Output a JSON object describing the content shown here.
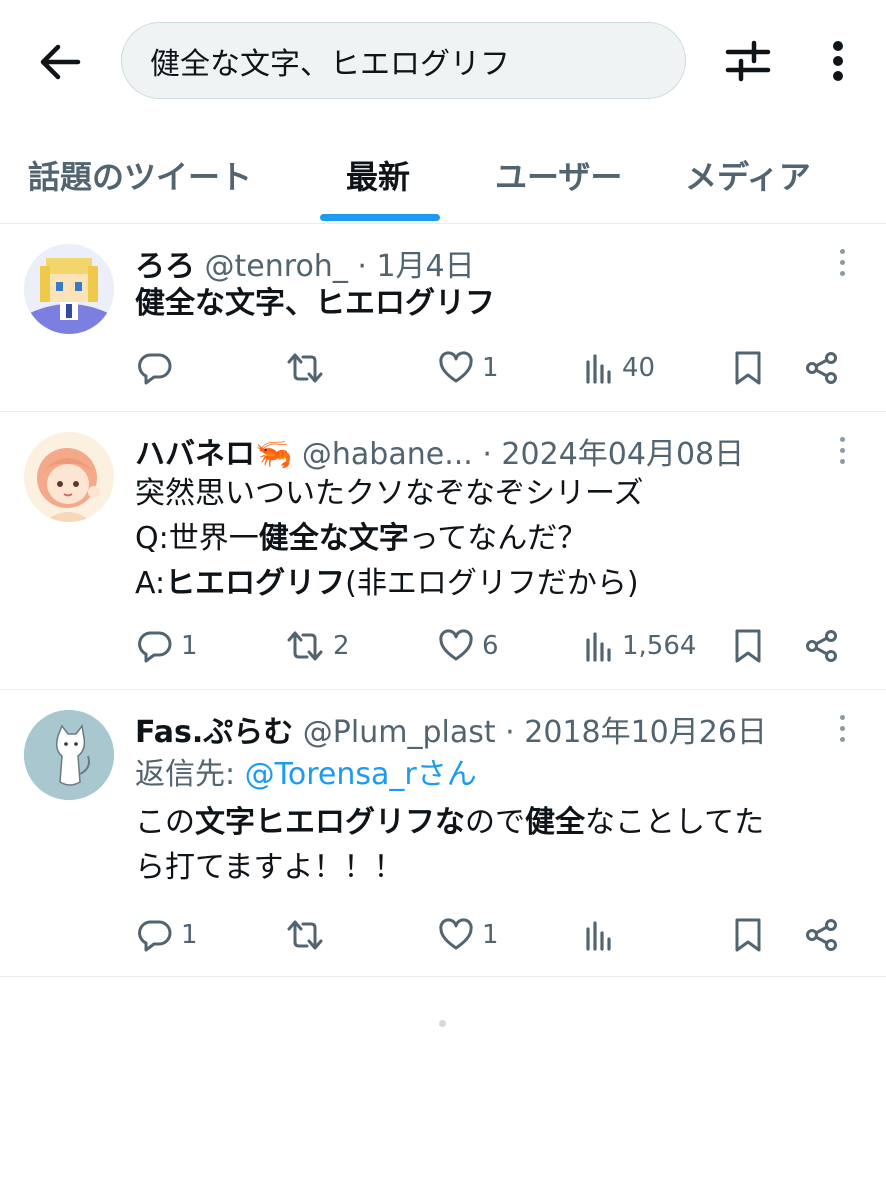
{
  "search": {
    "query": "健全な文字、ヒエログリフ"
  },
  "tabs": [
    "話題のツイート",
    "最新",
    "ユーザー",
    "メディア"
  ],
  "accent": "#1d9bf0",
  "icons": {
    "back": "arrow-left-icon",
    "filter": "sliders-icon",
    "more": "vertical-dots-icon",
    "reply": "reply-bubble-icon",
    "retweet": "retweet-icon",
    "like": "heart-icon",
    "views": "bar-chart-icon",
    "bookmark": "bookmark-icon",
    "share": "share-icon"
  },
  "tweets": [
    {
      "name": "ろろ",
      "handle": "@tenroh_",
      "date": "· 1月4日",
      "text": "健全な文字、ヒエログリフ",
      "replies": "",
      "retweets": "",
      "likes": "1",
      "views": "40"
    },
    {
      "name": "ハバネロ🦐",
      "handle": "@habane...",
      "date": "· 2024年04月08日",
      "lines": [
        [
          "突然思いついたクソなぞなぞシリーズ"
        ],
        [
          "Q:世界一",
          "健全な文字",
          "ってなんだ？"
        ],
        [
          "A:",
          "ヒエログリフ",
          "(非エログリフだから)"
        ]
      ],
      "replies": "1",
      "retweets": "2",
      "likes": "6",
      "views": "1,564"
    },
    {
      "name": "Fas.ぷらむ",
      "handle": "@Plum_plast",
      "date": "· 2018年10月26日",
      "reply_label": "返信先:",
      "reply_to": "@Torensa_rさん",
      "lines": [
        [
          "この",
          "文字ヒエログリフな",
          "ので",
          "健全",
          "なことしてた"
        ],
        [
          "ら打てますよ！！！"
        ]
      ],
      "replies": "1",
      "retweets": "",
      "likes": "1",
      "views": ""
    }
  ]
}
